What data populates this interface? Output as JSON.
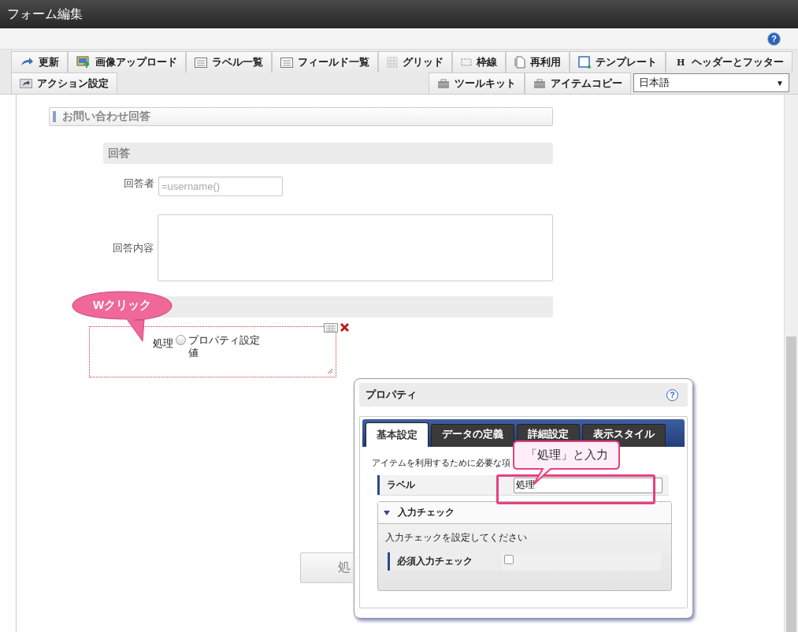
{
  "window": {
    "title": "フォーム編集",
    "help": "?"
  },
  "toolbar": {
    "row_1": [
      {
        "label": "更新"
      },
      {
        "label": "画像アップロード"
      },
      {
        "label": "ラベル一覧"
      },
      {
        "label": "フィールド一覧"
      },
      {
        "label": "グリッド"
      },
      {
        "label": "枠線"
      },
      {
        "label": "再利用"
      },
      {
        "label": "テンプレート"
      },
      {
        "label": "ヘッダーとフッター",
        "glyph": "H"
      }
    ],
    "row_2_left": [
      {
        "label": "アクション設定"
      }
    ],
    "row_2_right": [
      {
        "label": "ツールキット"
      },
      {
        "label": "アイテムコピー"
      }
    ],
    "language_select": {
      "value": "日本語",
      "arrow": "▼"
    }
  },
  "canvas": {
    "section_title": "お問い合わせ回答",
    "group_title": "回答",
    "fields": [
      {
        "kind": "input",
        "label": "回答者",
        "placeholder": "=username()"
      },
      {
        "kind": "textarea",
        "label": "回答内容"
      }
    ],
    "selected_item": {
      "label": "処理",
      "radio": {
        "label": "プロパティ設定値",
        "checked": false
      }
    },
    "button": {
      "label": "処"
    }
  },
  "property_dialog": {
    "title": "プロパティ",
    "help": "?",
    "tabs": [
      {
        "label": "基本設定",
        "selected": true
      },
      {
        "label": "データの定義",
        "selected": false
      },
      {
        "label": "詳細設定",
        "selected": false
      },
      {
        "label": "表示スタイル",
        "selected": false
      }
    ],
    "description": "アイテムを利用するために必要な項",
    "label_row": {
      "label": "ラベル",
      "value": "処理"
    },
    "input_check": {
      "title": "入力チェック",
      "expanded": true,
      "description": "入力チェックを設定してください",
      "rows": [
        {
          "label": "必須入力チェック",
          "checked": false
        }
      ]
    }
  },
  "callouts": [
    {
      "text": "Wクリック"
    },
    {
      "text": "「処理」と入力"
    }
  ]
}
